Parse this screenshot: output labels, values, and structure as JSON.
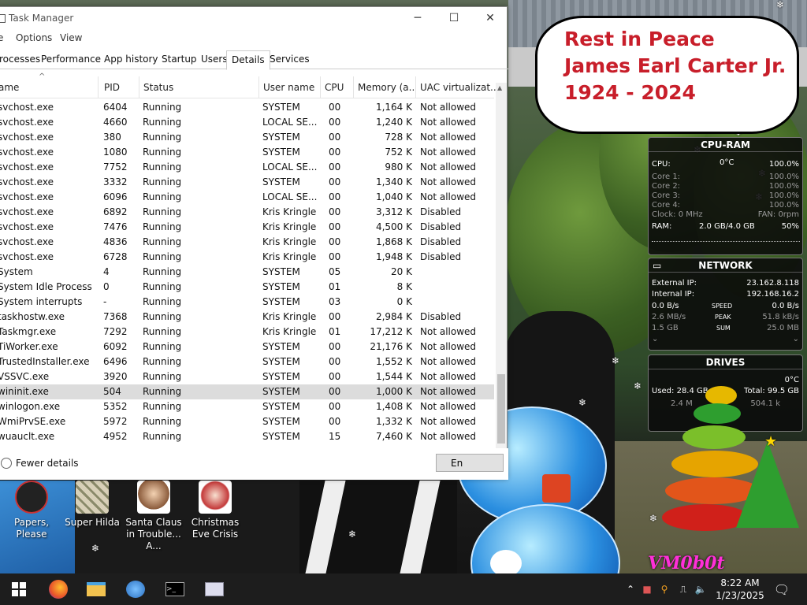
{
  "window": {
    "title": "Task Manager",
    "menu": [
      "e",
      "Options",
      "View"
    ],
    "tabs": [
      "rocesses",
      "Performance",
      "App history",
      "Startup",
      "Users",
      "Details",
      "Services"
    ],
    "active_tab": "Details",
    "columns": [
      "ame",
      "PID",
      "Status",
      "User name",
      "CPU",
      "Memory (a...",
      "UAC virtualizat..."
    ],
    "rows": [
      [
        "svchost.exe",
        "6404",
        "Running",
        "SYSTEM",
        "00",
        "1,164 K",
        "Not allowed"
      ],
      [
        "svchost.exe",
        "4660",
        "Running",
        "LOCAL SE...",
        "00",
        "1,240 K",
        "Not allowed"
      ],
      [
        "svchost.exe",
        "380",
        "Running",
        "SYSTEM",
        "00",
        "728 K",
        "Not allowed"
      ],
      [
        "svchost.exe",
        "1080",
        "Running",
        "SYSTEM",
        "00",
        "752 K",
        "Not allowed"
      ],
      [
        "svchost.exe",
        "7752",
        "Running",
        "LOCAL SE...",
        "00",
        "980 K",
        "Not allowed"
      ],
      [
        "svchost.exe",
        "3332",
        "Running",
        "SYSTEM",
        "00",
        "1,340 K",
        "Not allowed"
      ],
      [
        "svchost.exe",
        "6096",
        "Running",
        "LOCAL SE...",
        "00",
        "1,040 K",
        "Not allowed"
      ],
      [
        "svchost.exe",
        "6892",
        "Running",
        "Kris Kringle",
        "00",
        "3,312 K",
        "Disabled"
      ],
      [
        "svchost.exe",
        "7476",
        "Running",
        "Kris Kringle",
        "00",
        "4,500 K",
        "Disabled"
      ],
      [
        "svchost.exe",
        "4836",
        "Running",
        "Kris Kringle",
        "00",
        "1,868 K",
        "Disabled"
      ],
      [
        "svchost.exe",
        "6728",
        "Running",
        "Kris Kringle",
        "00",
        "1,948 K",
        "Disabled"
      ],
      [
        "System",
        "4",
        "Running",
        "SYSTEM",
        "05",
        "20 K",
        ""
      ],
      [
        "System Idle Process",
        "0",
        "Running",
        "SYSTEM",
        "01",
        "8 K",
        ""
      ],
      [
        "System interrupts",
        "-",
        "Running",
        "SYSTEM",
        "03",
        "0 K",
        ""
      ],
      [
        "taskhostw.exe",
        "7368",
        "Running",
        "Kris Kringle",
        "00",
        "2,984 K",
        "Disabled"
      ],
      [
        "Taskmgr.exe",
        "7292",
        "Running",
        "Kris Kringle",
        "01",
        "17,212 K",
        "Not allowed"
      ],
      [
        "TiWorker.exe",
        "6092",
        "Running",
        "SYSTEM",
        "00",
        "21,176 K",
        "Not allowed"
      ],
      [
        "TrustedInstaller.exe",
        "6496",
        "Running",
        "SYSTEM",
        "00",
        "1,552 K",
        "Not allowed"
      ],
      [
        "VSSVC.exe",
        "3920",
        "Running",
        "SYSTEM",
        "00",
        "1,544 K",
        "Not allowed"
      ],
      [
        "wininit.exe",
        "504",
        "Running",
        "SYSTEM",
        "00",
        "1,000 K",
        "Not allowed"
      ],
      [
        "winlogon.exe",
        "5352",
        "Running",
        "SYSTEM",
        "00",
        "1,408 K",
        "Not allowed"
      ],
      [
        "WmiPrvSE.exe",
        "5972",
        "Running",
        "SYSTEM",
        "00",
        "1,332 K",
        "Not allowed"
      ],
      [
        "wuauclt.exe",
        "4952",
        "Running",
        "SYSTEM",
        "15",
        "7,460 K",
        "Not allowed"
      ]
    ],
    "selected_process": "wininit.exe",
    "fewer_details": "Fewer details",
    "end_task": "En"
  },
  "bubble": {
    "line1": "Rest in Peace",
    "line2": "James Earl Carter Jr.",
    "line3": "1924 - 2024",
    "color": "#c81e2a"
  },
  "desktop_icons": [
    {
      "label": "Papers, Please",
      "color": "#222222"
    },
    {
      "label": "Super Hilda",
      "color": "#d8d0b8"
    },
    {
      "label": "Santa Claus in Trouble... A...",
      "color": "#8a5a3a"
    },
    {
      "label": "Christmas Eve Crisis",
      "color": "#c43a3a"
    }
  ],
  "cpu_ram": {
    "title": "CPU-RAM",
    "cpu_label": "CPU:",
    "cpu_temp": "0°C",
    "cpu_pct": "100.0%",
    "cores": [
      {
        "label": "Core 1:",
        "value": "100.0%"
      },
      {
        "label": "Core 2:",
        "value": "100.0%"
      },
      {
        "label": "Core 3:",
        "value": "100.0%"
      },
      {
        "label": "Core 4:",
        "value": "100.0%"
      }
    ],
    "clock": "Clock: 0 MHz",
    "fan": "FAN: 0rpm",
    "ram_label": "RAM:",
    "ram_value": "2.0 GB/4.0 GB",
    "ram_pct": "50%"
  },
  "network": {
    "title": "NETWORK",
    "ext_label": "External IP:",
    "ext_ip": "23.162.8.118",
    "int_label": "Internal IP:",
    "int_ip": "192.168.16.2",
    "speed_left": "0.0 B/s",
    "speed_label": "SPEED",
    "speed_right": "0.0 B/s",
    "peak_left": "2.6 MB/s",
    "peak_label": "PEAK",
    "peak_right": "51.8 kB/s",
    "sum_left": "1.5 GB",
    "sum_label": "SUM",
    "sum_right": "25.0 MB"
  },
  "drives": {
    "title": "DRIVES",
    "temp": "0°C",
    "used": "Used: 28.4 GB",
    "total": "Total: 99.5 GB",
    "read": "2.4 M",
    "write": "504.1 k"
  },
  "watermark": "VM0b0t",
  "taskbar": {
    "time": "8:22 AM",
    "date": "1/23/2025"
  }
}
